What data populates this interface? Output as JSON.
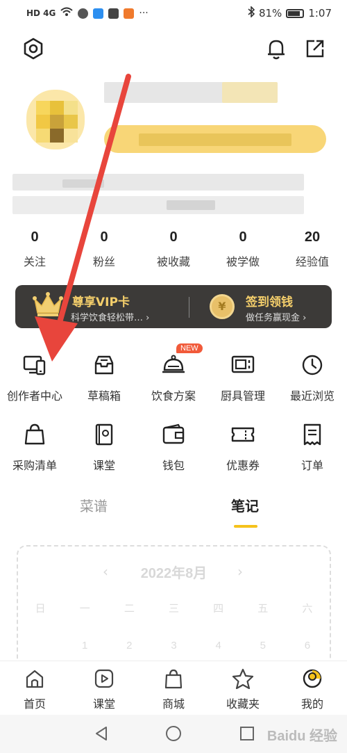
{
  "status_bar": {
    "left_text": "HD 4G",
    "battery": "81%",
    "time": "1:07"
  },
  "stats": [
    {
      "value": "0",
      "label": "关注"
    },
    {
      "value": "0",
      "label": "粉丝"
    },
    {
      "value": "0",
      "label": "被收藏"
    },
    {
      "value": "0",
      "label": "被学做"
    },
    {
      "value": "20",
      "label": "经验值"
    }
  ],
  "vip": {
    "title": "尊享VIP卡",
    "subtitle": "科学饮食轻松带… ›",
    "sign_title": "签到领钱",
    "sign_subtitle": "做任务赢现金 ›",
    "coin_symbol": "¥"
  },
  "grid_row1": [
    {
      "label": "创作者中心",
      "icon": "creator-center-icon"
    },
    {
      "label": "草稿箱",
      "icon": "drafts-icon"
    },
    {
      "label": "饮食方案",
      "icon": "diet-plan-icon",
      "badge": "NEW"
    },
    {
      "label": "厨具管理",
      "icon": "kitchenware-icon"
    },
    {
      "label": "最近浏览",
      "icon": "history-icon"
    }
  ],
  "grid_row2": [
    {
      "label": "采购清单",
      "icon": "shopping-list-icon"
    },
    {
      "label": "课堂",
      "icon": "class-icon"
    },
    {
      "label": "钱包",
      "icon": "wallet-icon"
    },
    {
      "label": "优惠券",
      "icon": "coupon-icon"
    },
    {
      "label": "订单",
      "icon": "order-icon"
    }
  ],
  "tabs": {
    "recipes": "菜谱",
    "notes": "笔记"
  },
  "calendar": {
    "month": "2022年8月",
    "prev": "‹",
    "next": "›",
    "weekdays": [
      "日",
      "一",
      "二",
      "三",
      "四",
      "五",
      "六"
    ],
    "row1": [
      "",
      "1",
      "2",
      "3",
      "4",
      "5",
      "6"
    ]
  },
  "bottom_nav": [
    {
      "label": "首页",
      "icon": "home-icon"
    },
    {
      "label": "课堂",
      "icon": "play-icon"
    },
    {
      "label": "商城",
      "icon": "shopping-bag-icon"
    },
    {
      "label": "收藏夹",
      "icon": "star-icon"
    },
    {
      "label": "我的",
      "icon": "profile-icon"
    }
  ],
  "watermark": "Baidu 经验",
  "colors": {
    "accent": "#f5c21b",
    "vip_bg": "#3c3a38",
    "vip_gold": "#f5cf6b",
    "badge_red": "#f15a3a",
    "annotation_arrow": "#e8453c"
  }
}
